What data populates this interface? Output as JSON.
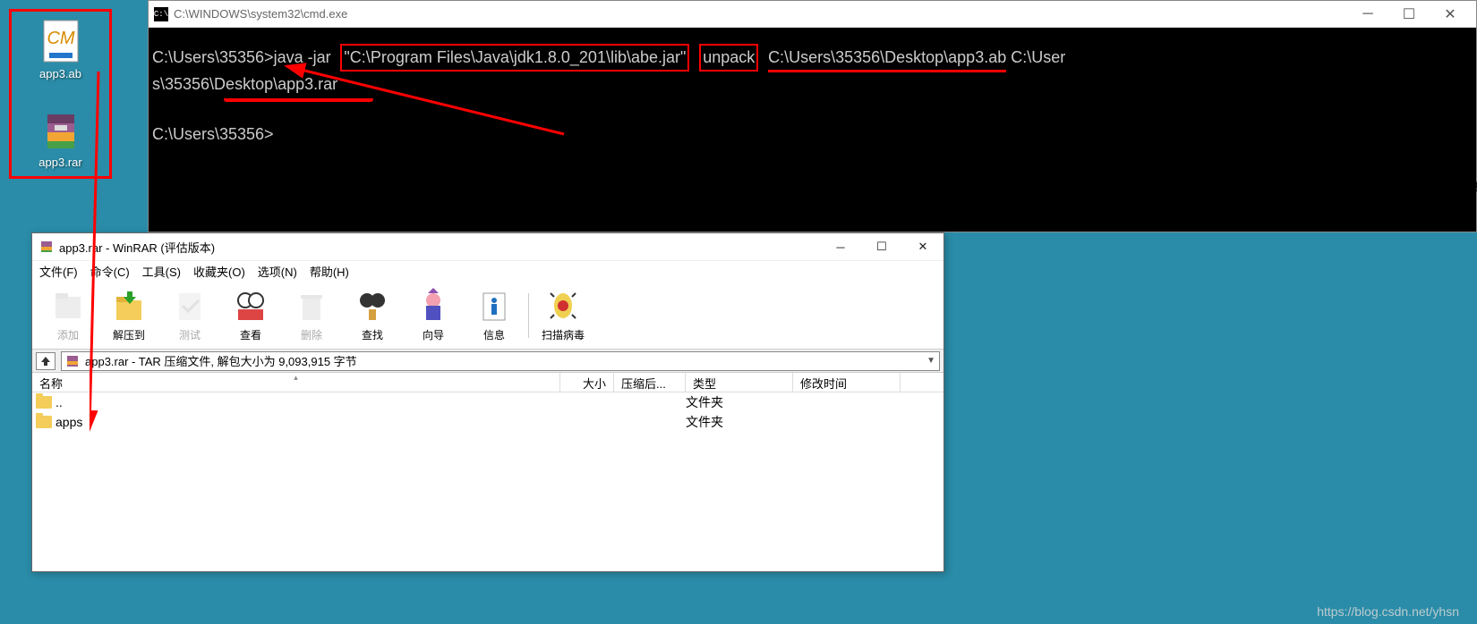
{
  "desktop": {
    "icons": [
      {
        "name": "app3-ab-file",
        "label": "app3.ab"
      },
      {
        "name": "app3-rar-file",
        "label": "app3.rar"
      }
    ]
  },
  "cmd": {
    "title": "C:\\WINDOWS\\system32\\cmd.exe",
    "line1_prompt": "C:\\Users\\35356>",
    "line1_cmd_a": "java -jar",
    "line1_cmd_b": "\"C:\\Program Files\\Java\\jdk1.8.0_201\\lib\\abe.jar\"",
    "line1_cmd_c": "unpack",
    "line1_cmd_d": "C:\\Users\\35356\\Desktop\\app3.ab",
    "line1_cmd_e": " C:\\User",
    "line2": "s\\35356\\Desktop\\",
    "line2_file": "app3.rar",
    "line3_prompt": "C:\\Users\\35356>"
  },
  "winrar": {
    "title": "app3.rar - WinRAR (评估版本)",
    "menu": {
      "file": "文件(F)",
      "cmd": "命令(C)",
      "tool": "工具(S)",
      "fav": "收藏夹(O)",
      "opt": "选项(N)",
      "help": "帮助(H)"
    },
    "toolbar": {
      "add": "添加",
      "extract": "解压到",
      "test": "测试",
      "view": "查看",
      "delete": "删除",
      "find": "查找",
      "wizard": "向导",
      "info": "信息",
      "scan": "扫描病毒"
    },
    "path_text": "app3.rar - TAR 压缩文件, 解包大小为 9,093,915 字节",
    "headers": {
      "name": "名称",
      "size": "大小",
      "packed": "压缩后...",
      "type": "类型",
      "mtime": "修改时间"
    },
    "rows": [
      {
        "name": "..",
        "type": "文件夹"
      },
      {
        "name": "apps",
        "type": "文件夹"
      }
    ]
  },
  "watermark": "https://blog.csdn.net/yhsn"
}
